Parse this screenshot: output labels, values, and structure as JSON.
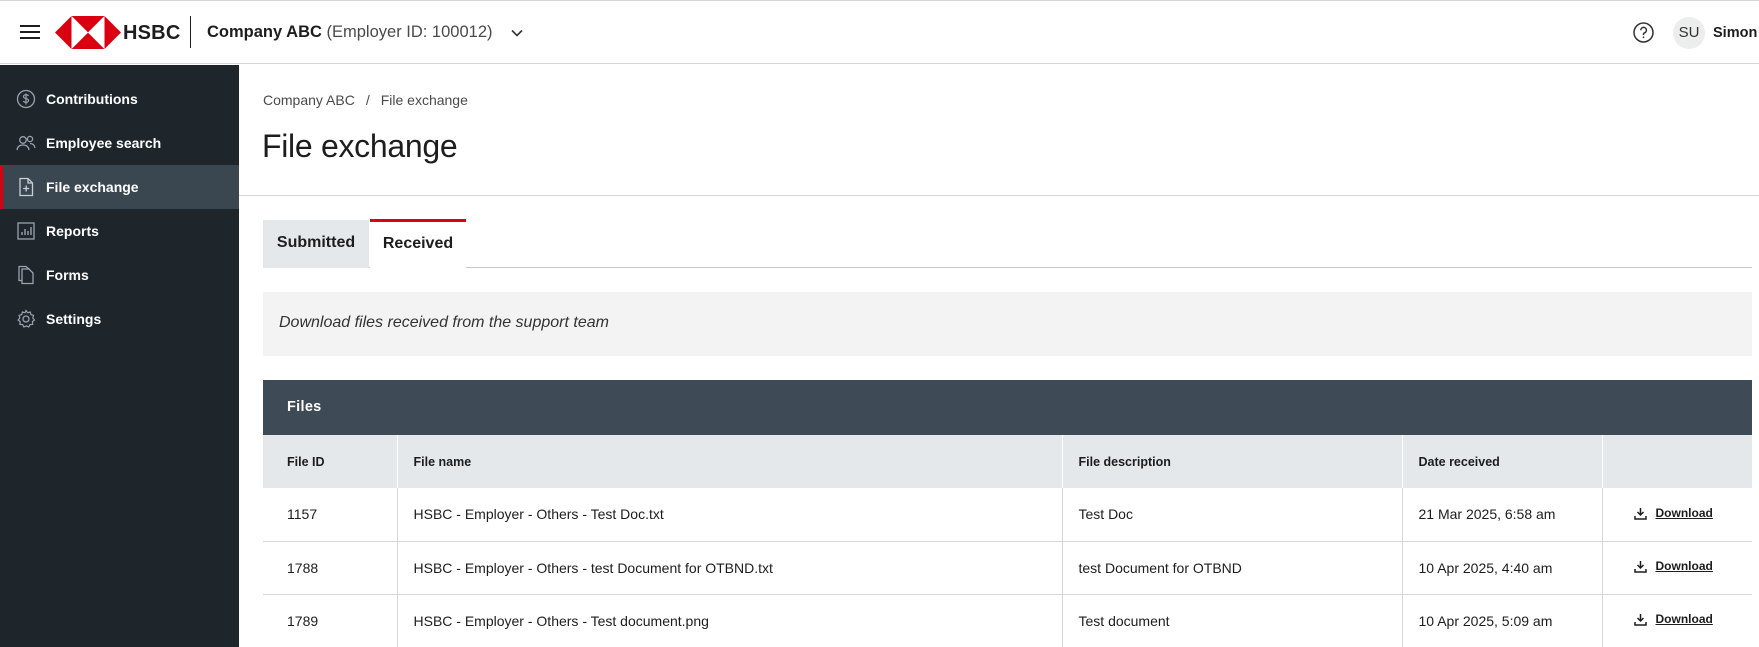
{
  "header": {
    "brand": "HSBC",
    "company_name": "Company ABC",
    "employer_id": "(Employer ID: 100012)",
    "user_initials": "SU",
    "user_name": "Simon",
    "brand_color": "#db0011"
  },
  "sidebar": {
    "items": [
      {
        "label": "Contributions",
        "icon": "dollar-circle-icon",
        "active": false
      },
      {
        "label": "Employee search",
        "icon": "people-icon",
        "active": false
      },
      {
        "label": "File exchange",
        "icon": "file-plus-icon",
        "active": true
      },
      {
        "label": "Reports",
        "icon": "bar-chart-icon",
        "active": false
      },
      {
        "label": "Forms",
        "icon": "documents-icon",
        "active": false
      },
      {
        "label": "Settings",
        "icon": "gear-icon",
        "active": false
      }
    ]
  },
  "breadcrumb": [
    "Company ABC",
    "File exchange"
  ],
  "page_title": "File exchange",
  "tabs": {
    "submitted": "Submitted",
    "received": "Received",
    "active": "received"
  },
  "notice": "Download files received from the support team",
  "files": {
    "title": "Files",
    "columns": [
      "File ID",
      "File name",
      "File description",
      "Date received",
      ""
    ],
    "download_label": "Download",
    "rows": [
      {
        "id": "1157",
        "name": "HSBC - Employer - Others - Test Doc.txt",
        "description": "Test Doc",
        "date": "21 Mar 2025, 6:58 am"
      },
      {
        "id": "1788",
        "name": "HSBC - Employer - Others - test Document for OTBND.txt",
        "description": "test Document for OTBND",
        "date": "10 Apr 2025, 4:40 am"
      },
      {
        "id": "1789",
        "name": "HSBC - Employer - Others - Test document.png",
        "description": "Test document",
        "date": "10 Apr 2025, 5:09 am"
      }
    ]
  }
}
